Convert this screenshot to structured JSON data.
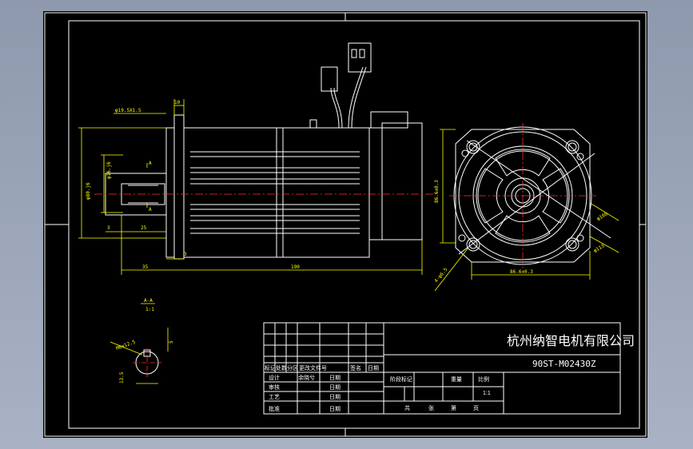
{
  "title_block": {
    "company": "杭州纳智电机有限公司",
    "part_number": "90ST-M02430Z",
    "rev_labels": [
      "标记",
      "处数",
      "分区",
      "更改文件号",
      "签名",
      "日期"
    ],
    "role_labels": [
      "设计",
      "审核",
      "工艺",
      "批准"
    ],
    "date_label": "日期",
    "designer": "余晓兮",
    "stage_labels": [
      "阶段标记",
      "重量",
      "比例"
    ],
    "scale": "1:1",
    "sheet_labels": [
      "共",
      "张",
      "第",
      "页"
    ]
  },
  "dimensions": {
    "pilot_dia": "φ19.5X1.5",
    "shaft_dia": "φ16.j6",
    "spigot_dia": "φ80.j6",
    "step_len": "10",
    "key_len": "3",
    "shaft_len": "25",
    "flange_thk": "35",
    "body_gap": "3",
    "total_len": "190",
    "square_side_v": "86.6±0.3",
    "square_side_h": "86.6±0.3",
    "bolt_circle": "φ100",
    "spigot_ref": "φ113",
    "hole_dia": "4-φ6.5",
    "section_label": "A-A",
    "section_scale": "1:1",
    "section_key": "M6x12.5",
    "section_depth": "5",
    "section_width": "13.5",
    "cut_mark": "A"
  }
}
